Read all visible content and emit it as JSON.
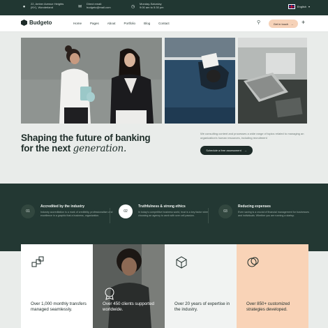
{
  "topbar": {
    "address_line1": "22, Amber Avenue Heights",
    "address_line2": "(NY), Wonderland",
    "email_label": "Direct email:",
    "email_value": "budgeto@mail.com",
    "hours_label": "Monday-Saturday",
    "hours_value": "9:00 am to 5:30 pm",
    "language": "English"
  },
  "header": {
    "logo": "Budgeto",
    "nav": [
      "Home",
      "Pages",
      "About",
      "Portfolio",
      "Blog",
      "Contact"
    ],
    "cta_label": "Get in touch"
  },
  "hero": {
    "title_line1": "Shaping the future of banking",
    "title_line2_plain": "for the next",
    "title_line2_italic": "generation.",
    "description": "We consulting content and processes a wide range of topics related to managing an organization's human resources, including recruitment",
    "button_label": "Schedule a free assessment"
  },
  "features": [
    {
      "number": "01",
      "title": "Accredited by the industry",
      "desc": "Industry accreditation is a mark of credibility, professionalism and excellence in a graphic that a business, organization."
    },
    {
      "number": "02",
      "title": "Truthfulness & strong ethics",
      "desc": "In today's competitive business world, trust is a key factor when choosing an agency to work with over cell passion."
    },
    {
      "number": "03",
      "title": "Reducing expenses",
      "desc": "Even saving is a crucial of financial management for businesses and individuals. Whether you are running a startup."
    }
  ],
  "stats": [
    {
      "text": "Over 1,000 monthly transfers managed seamlessly.",
      "icon": "blocks-icon"
    },
    {
      "text": "Over 450 clients supported worldwide.",
      "icon": "badge-icon"
    },
    {
      "text": "Over 20 years of expertise in the industry.",
      "icon": "box-icon"
    },
    {
      "text": "Over 850+ customized strategies developed.",
      "icon": "circles-icon"
    }
  ],
  "colors": {
    "dark": "#213732",
    "accent_peach": "#f6d2b8",
    "light_bg": "#e9ecea"
  }
}
